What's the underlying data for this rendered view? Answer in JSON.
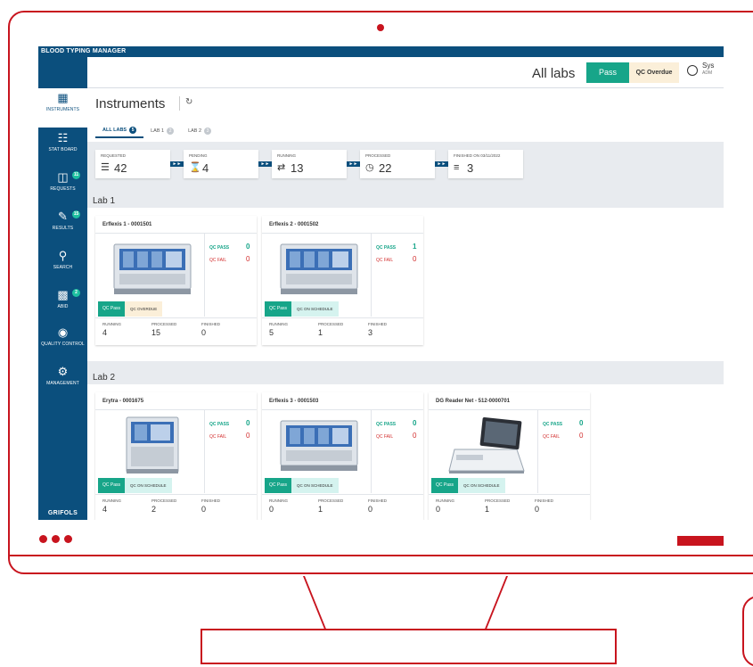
{
  "app": {
    "title": "BLOOD TYPING MANAGER",
    "brand": "GRIFOLS"
  },
  "topbar": {
    "title": "All labs",
    "pass_label": "Pass",
    "overdue_label": "QC Overdue",
    "user_name": "Sys",
    "user_role": "ADM"
  },
  "sidebar": {
    "items": [
      {
        "label": "INSTRUMENTS",
        "icon": "instruments-icon",
        "active": true
      },
      {
        "label": "STAT BOARD",
        "icon": "stat-board-icon"
      },
      {
        "label": "REQUESTS",
        "icon": "requests-icon",
        "badge": "11"
      },
      {
        "label": "RESULTS",
        "icon": "results-icon",
        "badge": "15"
      },
      {
        "label": "SEARCH",
        "icon": "search-icon"
      },
      {
        "label": "ABID",
        "icon": "abid-icon",
        "badge": "2"
      },
      {
        "label": "QUALITY CONTROL",
        "icon": "quality-control-icon"
      },
      {
        "label": "MANAGEMENT",
        "icon": "management-icon"
      }
    ]
  },
  "page": {
    "title": "Instruments",
    "tabs": [
      {
        "label": "ALL LABS",
        "badge": "5"
      },
      {
        "label": "LAB 1",
        "badge": "2"
      },
      {
        "label": "LAB 2",
        "badge": "3"
      }
    ]
  },
  "pipeline": [
    {
      "label": "REQUESTED",
      "value": "42",
      "icon": "list-icon"
    },
    {
      "label": "PENDING",
      "value": "4",
      "icon": "hourglass-icon"
    },
    {
      "label": "RUNNING",
      "value": "13",
      "icon": "arrows-icon"
    },
    {
      "label": "PROCESSED",
      "value": "22",
      "icon": "clock-icon"
    },
    {
      "label": "FINISHED ON 03/11/2022",
      "value": "3",
      "icon": "checklist-icon"
    }
  ],
  "labels": {
    "qc_pass": "QC PASS",
    "qc_fail": "QC FAIL",
    "running": "RUNNING",
    "processed": "PROCESSED",
    "finished": "FINISHED",
    "chip_pass": "QC Pass"
  },
  "labs": [
    {
      "name": "Lab 1",
      "instruments": [
        {
          "name": "Erflexis 1 - 0001501",
          "qc_pass": "0",
          "qc_fail": "0",
          "schedule": "QC OVERDUE",
          "running": "4",
          "processed": "15",
          "finished": "0"
        },
        {
          "name": "Erflexis 2 - 0001502",
          "qc_pass": "1",
          "qc_fail": "0",
          "schedule": "QC ON SCHEDULE",
          "running": "5",
          "processed": "1",
          "finished": "3"
        }
      ]
    },
    {
      "name": "Lab 2",
      "instruments": [
        {
          "name": "Erytra - 0001675",
          "qc_pass": "0",
          "qc_fail": "0",
          "schedule": "QC ON SCHEDULE",
          "running": "4",
          "processed": "2",
          "finished": "0"
        },
        {
          "name": "Erflexis 3 - 0001503",
          "qc_pass": "0",
          "qc_fail": "0",
          "schedule": "QC ON SCHEDULE",
          "running": "0",
          "processed": "1",
          "finished": "0"
        },
        {
          "name": "DG Reader Net - 512-0000701",
          "qc_pass": "0",
          "qc_fail": "0",
          "schedule": "QC ON SCHEDULE",
          "running": "0",
          "processed": "1",
          "finished": "0"
        }
      ]
    }
  ]
}
